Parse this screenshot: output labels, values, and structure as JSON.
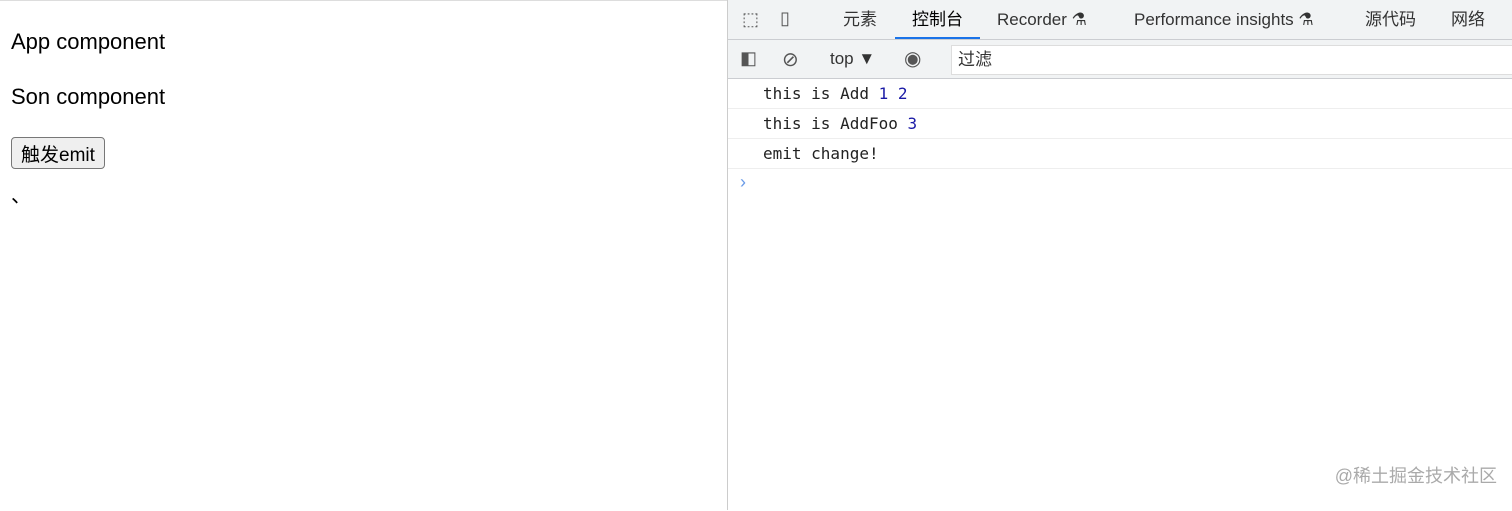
{
  "page": {
    "app_text": "App component",
    "son_text": "Son component",
    "button": "触发emit",
    "mark": "、"
  },
  "devtools": {
    "tabs": [
      "元素",
      "控制台",
      "Recorder",
      "Performance insights",
      "源代码",
      "网络"
    ],
    "context": "top ▼",
    "filter_placeholder": "过滤",
    "logs": [
      {
        "text": "this is Add ",
        "nums": "1 2"
      },
      {
        "text": "this is AddFoo ",
        "nums": "3"
      },
      {
        "text": "emit change!",
        "nums": ""
      }
    ],
    "prompt": "›"
  },
  "watermark": "@稀土掘金技术社区"
}
